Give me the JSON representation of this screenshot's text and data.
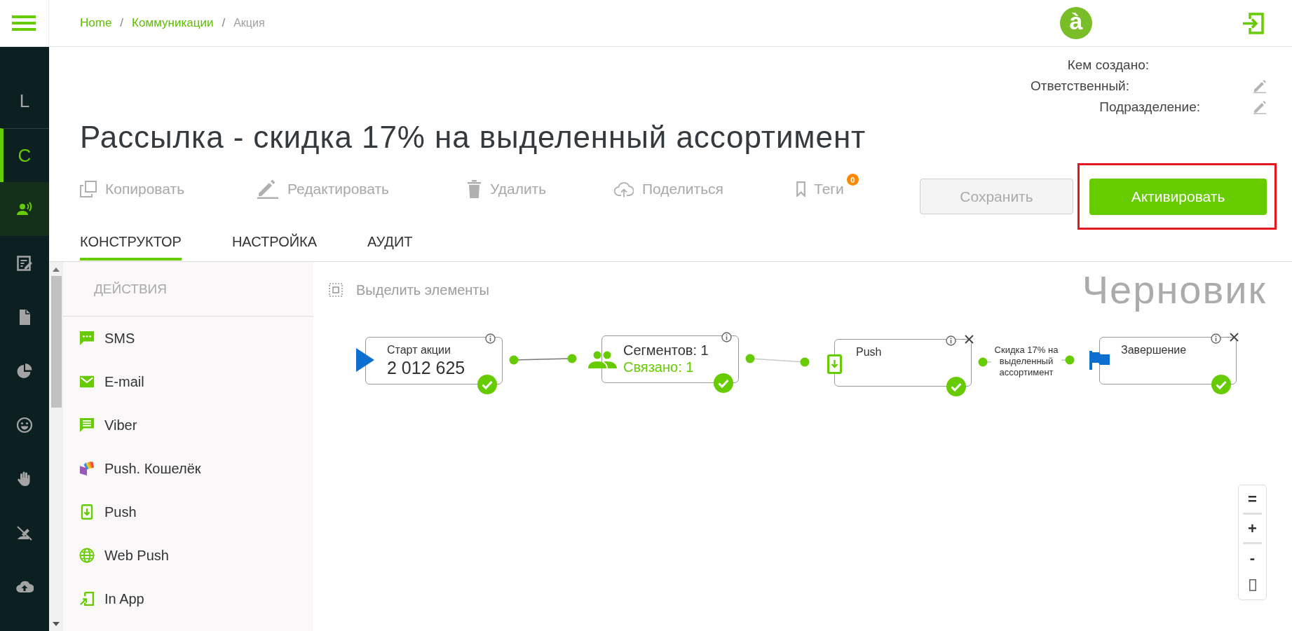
{
  "topbar": {
    "breadcrumbs": [
      {
        "label": "Home",
        "current": false,
        "separator": "/"
      },
      {
        "label": "Коммуникации",
        "current": false,
        "separator": "/"
      },
      {
        "label": "Акция",
        "current": true
      }
    ],
    "logo": "à"
  },
  "rail": [
    {
      "kind": "letter",
      "label": "L",
      "selected": false,
      "current": false
    },
    {
      "kind": "letter",
      "label": "C",
      "selected": true,
      "current": false
    },
    {
      "kind": "icon",
      "selected": false,
      "current": true
    },
    {
      "kind": "icon",
      "selected": false,
      "current": false
    },
    {
      "kind": "icon",
      "selected": false,
      "current": false
    },
    {
      "kind": "icon",
      "selected": false,
      "current": false
    },
    {
      "kind": "icon",
      "selected": false,
      "current": false
    },
    {
      "kind": "icon",
      "selected": false,
      "current": false
    },
    {
      "kind": "icon",
      "selected": false,
      "current": false
    },
    {
      "kind": "icon",
      "selected": false,
      "current": false
    }
  ],
  "meta": [
    {
      "label": "Кем создано:",
      "editable": false
    },
    {
      "label": "Ответственный:",
      "editable": true
    },
    {
      "label": "Подразделение:",
      "editable": true
    }
  ],
  "title": "Рассылка - скидка 17% на выделенный ассортимент",
  "toolbar": [
    {
      "label": "Копировать"
    },
    {
      "label": "Редактировать"
    },
    {
      "label": "Удалить"
    },
    {
      "label": "Поделиться"
    },
    {
      "label": "Теги",
      "badge": "0"
    }
  ],
  "buttons": [
    {
      "label": "Сохранить",
      "kind": "secondary",
      "disabled": true,
      "highlighted": false
    },
    {
      "label": "Активировать",
      "kind": "primary",
      "disabled": false,
      "highlighted": true
    }
  ],
  "tabs": [
    {
      "label": "КОНСТРУКТОР",
      "selected": true
    },
    {
      "label": "НАСТРОЙКА",
      "selected": false
    },
    {
      "label": "АУДИТ",
      "selected": false
    }
  ],
  "actions": {
    "heading": "ДЕЙСТВИЯ",
    "items": [
      {
        "label": "SMS"
      },
      {
        "label": "E-mail"
      },
      {
        "label": "Viber"
      },
      {
        "label": "Push. Кошелёк"
      },
      {
        "label": "Push"
      },
      {
        "label": "Web Push"
      },
      {
        "label": "In App"
      }
    ]
  },
  "canvas": {
    "select_tool": {
      "label": "Выделить элементы",
      "disabled": true
    },
    "status": "Черновик",
    "nodes": [
      {
        "kind": "start",
        "title": "Старт акции",
        "value": "2 012 625",
        "valid": true,
        "removable": false
      },
      {
        "kind": "segment",
        "title": "Сегментов: 1",
        "subtitle": "Связано: 1",
        "valid": true,
        "removable": false
      },
      {
        "kind": "push",
        "title": "Push",
        "valid": true,
        "removable": true,
        "link_label": "Скидка 17% на выделенный ассортимент"
      },
      {
        "kind": "end",
        "title": "Завершение",
        "valid": true,
        "removable": true
      }
    ],
    "zoom_controls": [
      "=",
      "+",
      "-"
    ]
  }
}
